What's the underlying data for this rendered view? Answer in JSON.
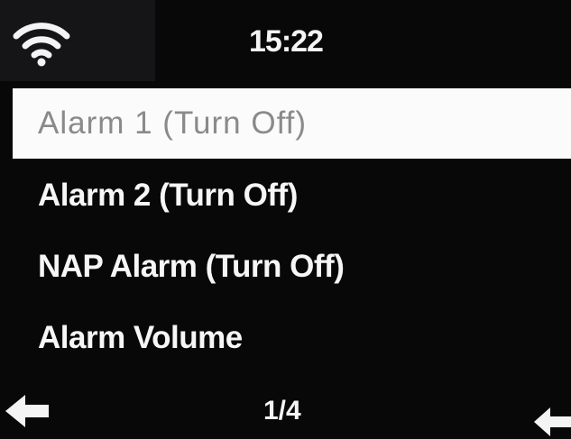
{
  "status": {
    "time": "15:22",
    "wifi_icon": "wifi-icon"
  },
  "menu": {
    "items": [
      {
        "label": "Alarm 1 (Turn Off)",
        "selected": true
      },
      {
        "label": "Alarm 2 (Turn Off)",
        "selected": false
      },
      {
        "label": "NAP Alarm (Turn Off)",
        "selected": false
      },
      {
        "label": "Alarm Volume",
        "selected": false
      }
    ]
  },
  "footer": {
    "page": "1/4",
    "back_icon": "left-arrow-icon",
    "enter_icon": "enter-arrow-icon"
  },
  "colors": {
    "background": "#080808",
    "highlight": "#fbfbfb",
    "selected_text": "#8a8a8a",
    "text": "#f4f4f4"
  }
}
